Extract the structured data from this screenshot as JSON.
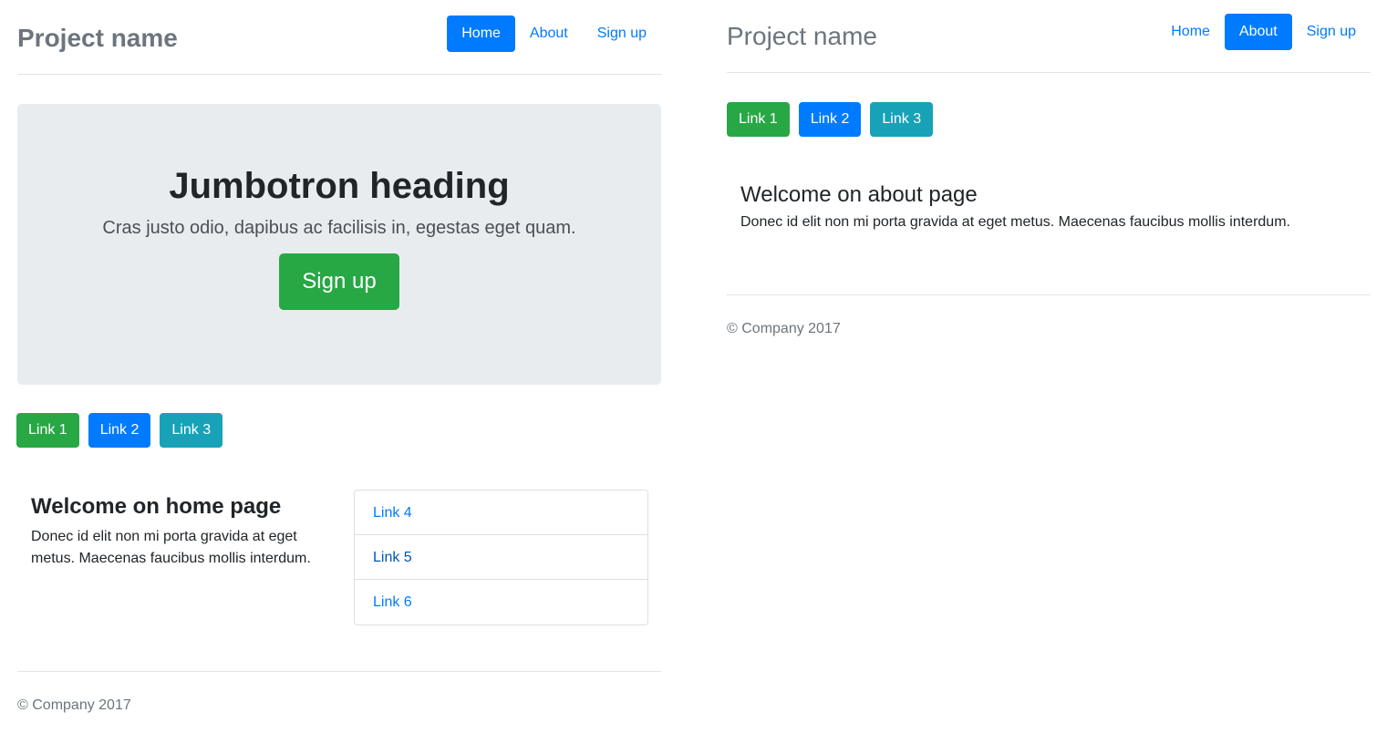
{
  "left": {
    "brand": "Project name",
    "nav": [
      "Home",
      "About",
      "Sign up"
    ],
    "jumbotron": {
      "heading": "Jumbotron heading",
      "lead": "Cras justo odio, dapibus ac facilisis in, egestas eget quam.",
      "button": "Sign up"
    },
    "links": [
      "Link 1",
      "Link 2",
      "Link 3"
    ],
    "welcome_title": "Welcome on home page",
    "welcome_text": "Donec id elit non mi porta gravida at eget metus. Maecenas faucibus mollis interdum.",
    "list": [
      "Link 4",
      "Link 5",
      "Link 6"
    ],
    "footer": "© Company 2017"
  },
  "right": {
    "brand": "Project name",
    "nav": [
      "Home",
      "About",
      "Sign up"
    ],
    "links": [
      "Link 1",
      "Link 2",
      "Link 3"
    ],
    "welcome_title": "Welcome on about page",
    "welcome_text": "Donec id elit non mi porta gravida at eget metus. Maecenas faucibus mollis interdum.",
    "footer": "© Company 2017"
  },
  "colors": {
    "primary": "#007bff",
    "success": "#28a745",
    "info": "#17a2b8",
    "muted": "#6c757d",
    "jumbotron_bg": "#e9ecef"
  }
}
